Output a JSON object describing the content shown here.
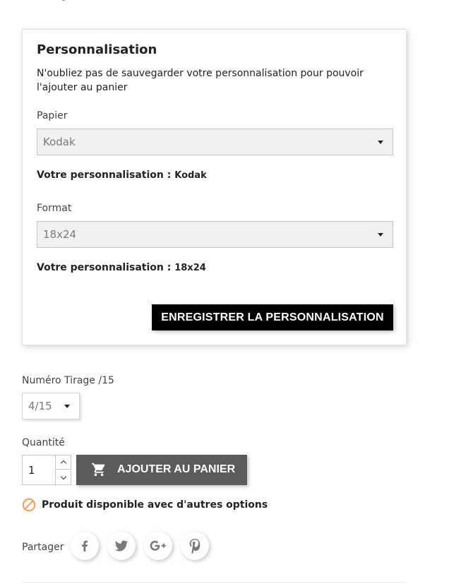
{
  "customization": {
    "title": "Personnalisation",
    "description": "N'oubliez pas de sauvegarder votre personnalisation pour pouvoir l'ajouter au panier",
    "fields": [
      {
        "label": "Papier",
        "value": "Kodak",
        "summary_label": "Votre personnalisation :",
        "summary_value": "Kodak"
      },
      {
        "label": "Format",
        "value": "18x24",
        "summary_label": "Votre personnalisation :",
        "summary_value": "18x24"
      }
    ],
    "save_button": "ENREGISTRER LA PERSONNALISATION"
  },
  "tirage": {
    "label": "Numéro Tirage /15",
    "value": "4/15"
  },
  "quantity": {
    "label": "Quantité",
    "value": "1"
  },
  "add_to_cart": {
    "label": "AJOUTER AU PANIER",
    "icon": "cart-icon"
  },
  "availability": {
    "text": "Produit disponible avec d'autres options",
    "icon": "ban-icon",
    "color": "#ff9a52"
  },
  "share": {
    "label": "Partager",
    "networks": [
      "facebook",
      "twitter",
      "google-plus",
      "pinterest"
    ]
  },
  "colors": {
    "primary_button": "#000000",
    "cart_button": "#5b5b5b",
    "icon_grey": "#7a7a7a"
  }
}
